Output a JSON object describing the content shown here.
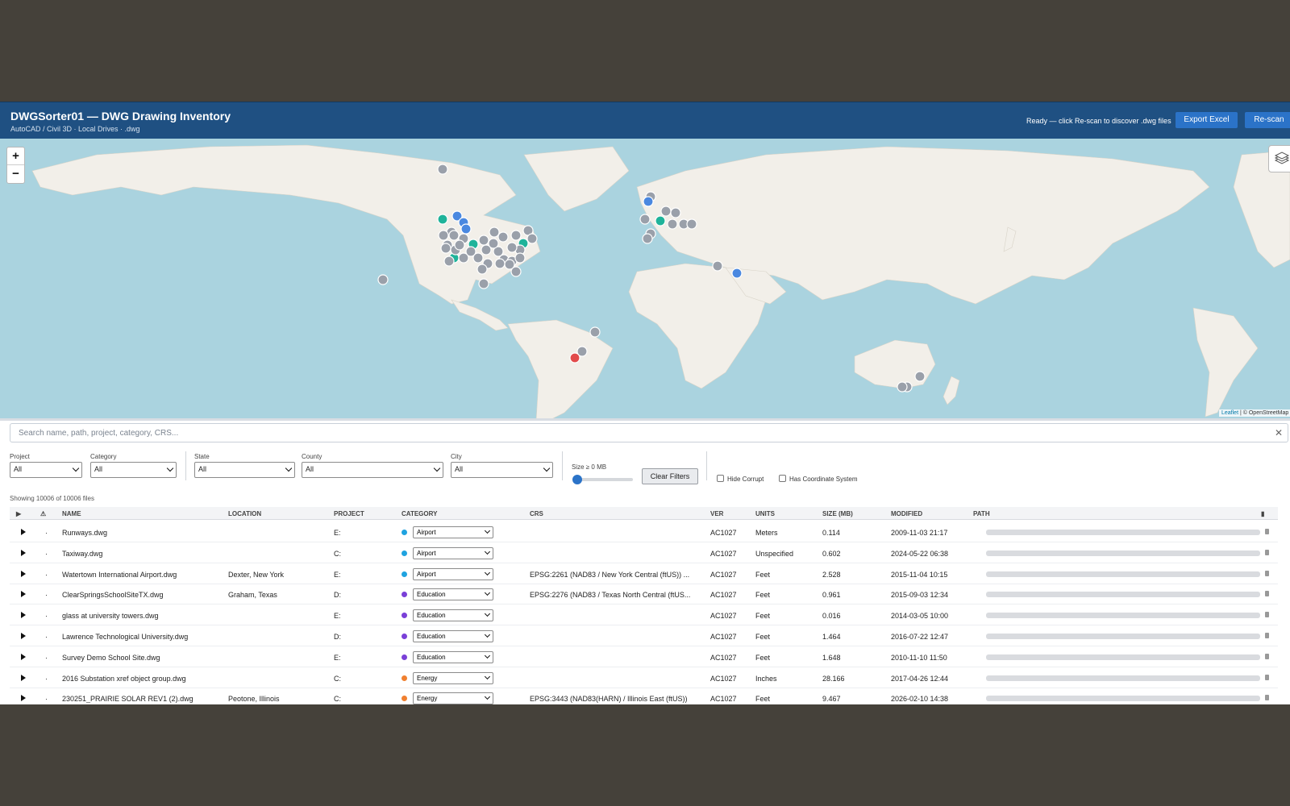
{
  "header": {
    "title": "DWGSorter01 — DWG Drawing Inventory",
    "subtitle": "AutoCAD / Civil 3D · Local Drives · .dwg",
    "status": "Ready — click Re-scan to discover .dwg files",
    "export_label": "Export Excel",
    "rescan_label": "Re-scan"
  },
  "map": {
    "zoom_in": "+",
    "zoom_out": "−",
    "attribution_leaflet": "Leaflet",
    "attribution_rest": "| © OpenStreetMap",
    "colors": {
      "gray": "#9aa0aa",
      "blue": "#4a88e0",
      "teal": "#1fb39a",
      "red": "#e24b4b",
      "orange": "#f08030",
      "purple": "#7a40d8"
    }
  },
  "search": {
    "placeholder": "Search name, path, project, category, CRS..."
  },
  "filters": {
    "project": {
      "label": "Project",
      "value": "All"
    },
    "category": {
      "label": "Category",
      "value": "All"
    },
    "state": {
      "label": "State",
      "value": "All"
    },
    "county": {
      "label": "County",
      "value": "All"
    },
    "city": {
      "label": "City",
      "value": "All"
    },
    "size_label": "Size ≥ 0 MB",
    "size_min": 0,
    "clear_label": "Clear Filters",
    "hide_corrupt": "Hide Corrupt",
    "has_crs": "Has Coordinate System",
    "showing": "Showing 10006 of 10006 files"
  },
  "table": {
    "columns": [
      "NAME",
      "LOCATION",
      "PROJECT",
      "CATEGORY",
      "CRS",
      "VER",
      "UNITS",
      "SIZE (MB)",
      "MODIFIED",
      "PATH"
    ],
    "rows": [
      {
        "name": "Runways.dwg",
        "location": "",
        "project": "E:",
        "category": "Airport",
        "cat_color": "#1fa3e0",
        "crs": "",
        "ver": "AC1027",
        "units": "Meters",
        "size": "0.114",
        "modified": "2009-11-03 21:17"
      },
      {
        "name": "Taxiway.dwg",
        "location": "",
        "project": "C:",
        "category": "Airport",
        "cat_color": "#1fa3e0",
        "crs": "",
        "ver": "AC1027",
        "units": "Unspecified",
        "size": "0.602",
        "modified": "2024-05-22 06:38"
      },
      {
        "name": "Watertown International Airport.dwg",
        "location": "Dexter, New York",
        "project": "E:",
        "category": "Airport",
        "cat_color": "#1fa3e0",
        "crs": "EPSG:2261 (NAD83 / New York Central (ftUS)) ...",
        "ver": "AC1027",
        "units": "Feet",
        "size": "2.528",
        "modified": "2015-11-04 10:15"
      },
      {
        "name": "ClearSpringsSchoolSiteTX.dwg",
        "location": "Graham, Texas",
        "project": "D:",
        "category": "Education",
        "cat_color": "#7a40d8",
        "crs": "EPSG:2276 (NAD83 / Texas North Central (ftUS...",
        "ver": "AC1027",
        "units": "Feet",
        "size": "0.961",
        "modified": "2015-09-03 12:34"
      },
      {
        "name": "glass at university towers.dwg",
        "location": "",
        "project": "E:",
        "category": "Education",
        "cat_color": "#7a40d8",
        "crs": "",
        "ver": "AC1027",
        "units": "Feet",
        "size": "0.016",
        "modified": "2014-03-05 10:00"
      },
      {
        "name": "Lawrence Technological University.dwg",
        "location": "",
        "project": "D:",
        "category": "Education",
        "cat_color": "#7a40d8",
        "crs": "",
        "ver": "AC1027",
        "units": "Feet",
        "size": "1.464",
        "modified": "2016-07-22 12:47"
      },
      {
        "name": "Survey Demo School Site.dwg",
        "location": "",
        "project": "E:",
        "category": "Education",
        "cat_color": "#7a40d8",
        "crs": "",
        "ver": "AC1027",
        "units": "Feet",
        "size": "1.648",
        "modified": "2010-11-10 11:50"
      },
      {
        "name": "2016 Substation xref object group.dwg",
        "location": "",
        "project": "C:",
        "category": "Energy",
        "cat_color": "#f08030",
        "crs": "",
        "ver": "AC1027",
        "units": "Inches",
        "size": "28.166",
        "modified": "2017-04-26 12:44"
      },
      {
        "name": "230251_PRAIRIE SOLAR REV1 (2).dwg",
        "location": "Peotone, Illinois",
        "project": "C:",
        "category": "Energy",
        "cat_color": "#f08030",
        "crs": "EPSG:3443 (NAD83(HARN) / Illinois East (ftUS))",
        "ver": "AC1027",
        "units": "Feet",
        "size": "9.467",
        "modified": "2026-02-10 14:38"
      }
    ]
  }
}
